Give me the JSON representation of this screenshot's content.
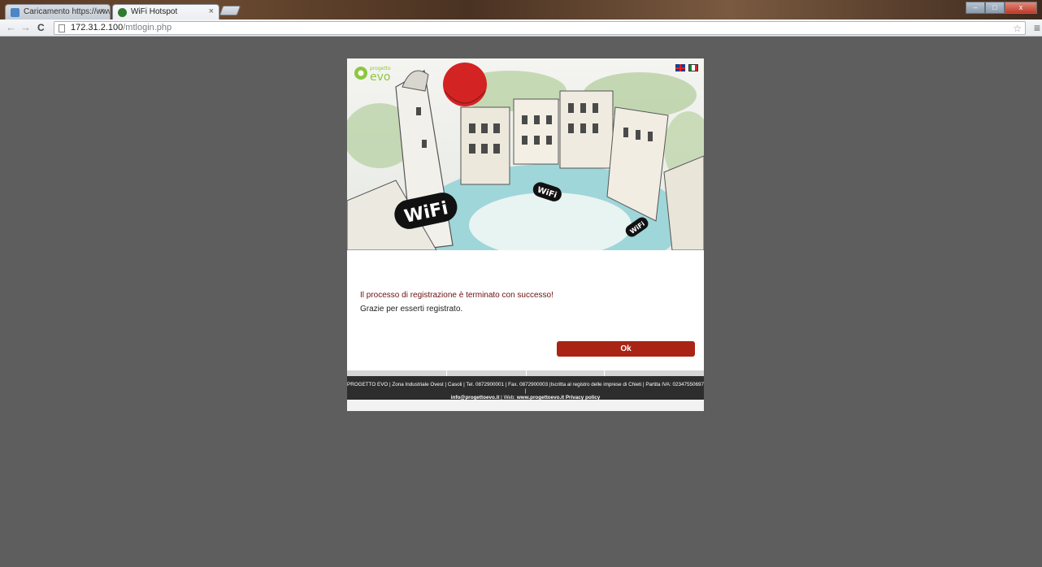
{
  "browser": {
    "tabs": [
      {
        "title": "Caricamento https://www.",
        "favicon_color": "#4a86c8"
      },
      {
        "title": "WiFi Hotspot",
        "favicon_color": "#2f7a2f"
      }
    ],
    "close_glyph": "×",
    "url_host": "172.31.2.100",
    "url_path": "/mtlogin.php",
    "window_buttons": {
      "minimize": "–",
      "maximize": "□",
      "close": "x"
    }
  },
  "page": {
    "logo_small": "progetto",
    "logo_big": "evo",
    "hero_badges": [
      "WiFi",
      "WiFi",
      "WiFi"
    ],
    "message_line1": "Il processo di registrazione è terminato con successo!",
    "message_line2": "Grazie per esserti registrato.",
    "ok_label": "Ok",
    "footer_line1": "PROGETTO EVO | Zona Industriale Ovest | Casoli | Tel. 0872900001 | Fax. 0872900003 |Iscritta al registro delle imprese di Chieti | Partita IVA: 02347550697 |",
    "footer_email": "info@progettoevo.it",
    "footer_web_label": " | Web: ",
    "footer_web": "www.progettoevo.it",
    "footer_privacy": "Privacy policy"
  },
  "colors": {
    "background": "#5e5e5e",
    "button": "#a92414",
    "footer": "#2d2d2d",
    "logo_green": "#8dc63f"
  },
  "icons": [
    "back-icon",
    "forward-icon",
    "reload-icon",
    "page-icon",
    "star-icon",
    "menu-icon",
    "flag-uk-icon",
    "flag-it-icon"
  ]
}
